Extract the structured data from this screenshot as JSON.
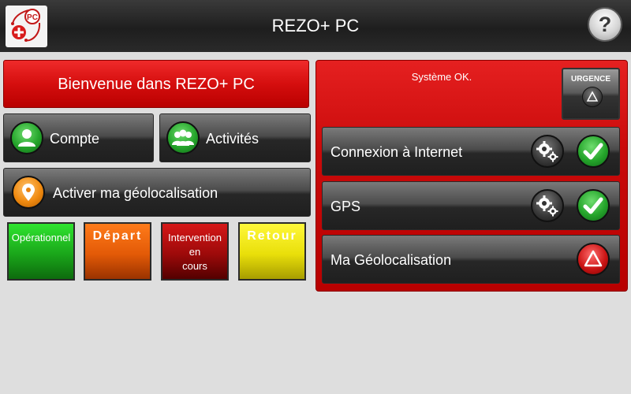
{
  "header": {
    "title": "REZO+ PC",
    "help_label": "?",
    "logo_text": "PC"
  },
  "left": {
    "welcome": "Bienvenue dans REZO+ PC",
    "compte": "Compte",
    "activites": "Activités",
    "geoloc": "Activer ma géolocalisation"
  },
  "status_tiles": {
    "operationnel": "Opérationnel",
    "depart": "Départ",
    "intervention": [
      "Intervention",
      "en",
      "cours"
    ],
    "retour": "Retour"
  },
  "right": {
    "system_message": "Système OK.",
    "urgence": "URGENCE",
    "internet": "Connexion à Internet",
    "gps": "GPS",
    "ma_geoloc": "Ma Géolocalisation"
  },
  "colors": {
    "accent_red": "#cc0d0d",
    "ok_green": "#25a52b",
    "operationnel": "#1aa61a",
    "depart": "#e35a07",
    "intervention": "#9d0a0a",
    "retour": "#e9df0a"
  },
  "icons": {
    "compte": "user-icon",
    "activites": "group-icon",
    "geoloc": "location-pin-icon",
    "settings": "gears-icon",
    "status_ok": "check-icon",
    "warning": "warning-triangle-icon"
  }
}
